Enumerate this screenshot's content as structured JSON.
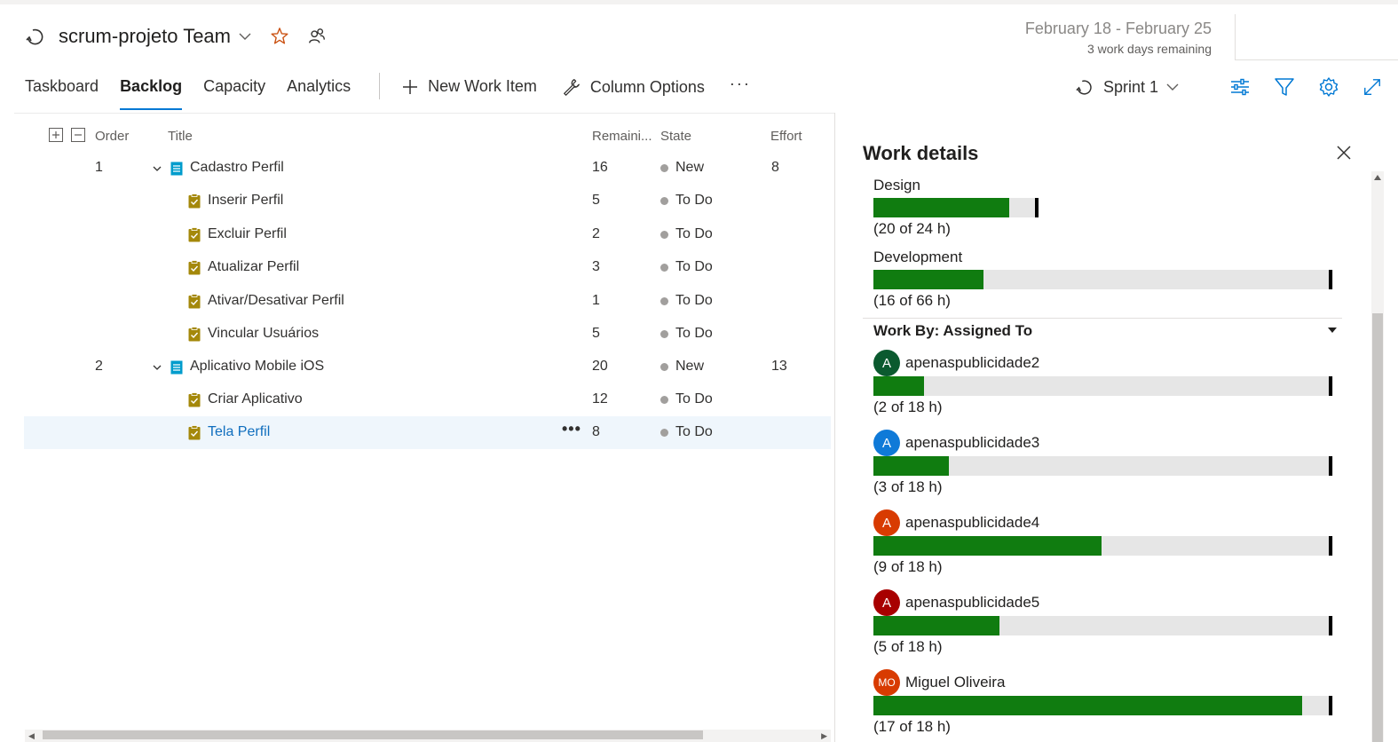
{
  "header": {
    "team_name": "scrum-projeto Team",
    "sprint_dates": "February 18 - February 25",
    "days_remaining": "3 work days remaining"
  },
  "nav": {
    "tabs": [
      {
        "label": "Taskboard",
        "active": false
      },
      {
        "label": "Backlog",
        "active": true
      },
      {
        "label": "Capacity",
        "active": false
      },
      {
        "label": "Analytics",
        "active": false
      }
    ],
    "new_work_item": "New Work Item",
    "column_options": "Column Options",
    "more": "···",
    "sprint_label": "Sprint 1"
  },
  "grid": {
    "columns": {
      "order": "Order",
      "title": "Title",
      "remaining": "Remaini...",
      "state": "State",
      "effort": "Effort"
    },
    "rows": [
      {
        "type": "pbi",
        "order": "1",
        "title": "Cadastro Perfil",
        "remaining": "16",
        "state": "New",
        "effort": "8"
      },
      {
        "type": "task",
        "order": "",
        "title": "Inserir Perfil",
        "remaining": "5",
        "state": "To Do",
        "effort": ""
      },
      {
        "type": "task",
        "order": "",
        "title": "Excluir Perfil",
        "remaining": "2",
        "state": "To Do",
        "effort": ""
      },
      {
        "type": "task",
        "order": "",
        "title": "Atualizar Perfil",
        "remaining": "3",
        "state": "To Do",
        "effort": ""
      },
      {
        "type": "task",
        "order": "",
        "title": "Ativar/Desativar Perfil",
        "remaining": "1",
        "state": "To Do",
        "effort": ""
      },
      {
        "type": "task",
        "order": "",
        "title": "Vincular Usuários",
        "remaining": "5",
        "state": "To Do",
        "effort": ""
      },
      {
        "type": "pbi",
        "order": "2",
        "title": "Aplicativo Mobile iOS",
        "remaining": "20",
        "state": "New",
        "effort": "13"
      },
      {
        "type": "task",
        "order": "",
        "title": "Criar Aplicativo",
        "remaining": "12",
        "state": "To Do",
        "effort": ""
      },
      {
        "type": "task",
        "order": "",
        "title": "Tela Perfil",
        "remaining": "8",
        "state": "To Do",
        "effort": "",
        "selected": true
      }
    ],
    "row_more": "•••"
  },
  "work_details": {
    "title": "Work details",
    "activities": [
      {
        "label": "Design",
        "hours_text": "(20 of 24 h)",
        "assigned": 20,
        "capacity": 24
      },
      {
        "label": "Development",
        "hours_text": "(16 of 66 h)",
        "assigned": 16,
        "capacity": 66
      }
    ],
    "assigned_to_title": "Work By: Assigned To",
    "people": [
      {
        "initials": "A",
        "name": "apenaspublicidade2",
        "hours_text": "(2 of 18 h)",
        "assigned": 2,
        "capacity": 18,
        "color": "#0b5a2f"
      },
      {
        "initials": "A",
        "name": "apenaspublicidade3",
        "hours_text": "(3 of 18 h)",
        "assigned": 3,
        "capacity": 18,
        "color": "#0f7ad8"
      },
      {
        "initials": "A",
        "name": "apenaspublicidade4",
        "hours_text": "(9 of 18 h)",
        "assigned": 9,
        "capacity": 18,
        "color": "#d83b01"
      },
      {
        "initials": "A",
        "name": "apenaspublicidade5",
        "hours_text": "(5 of 18 h)",
        "assigned": 5,
        "capacity": 18,
        "color": "#a80000"
      },
      {
        "initials": "MO",
        "name": "Miguel Oliveira",
        "hours_text": "(17 of 18 h)",
        "assigned": 17,
        "capacity": 18,
        "color": "#d83b01"
      }
    ]
  },
  "colors": {
    "accent": "#0078d4",
    "bar_fill": "#107c10",
    "bar_track": "#e6e6e6",
    "task_icon": "#a4880a",
    "pbi_icon": "#009ccc"
  }
}
